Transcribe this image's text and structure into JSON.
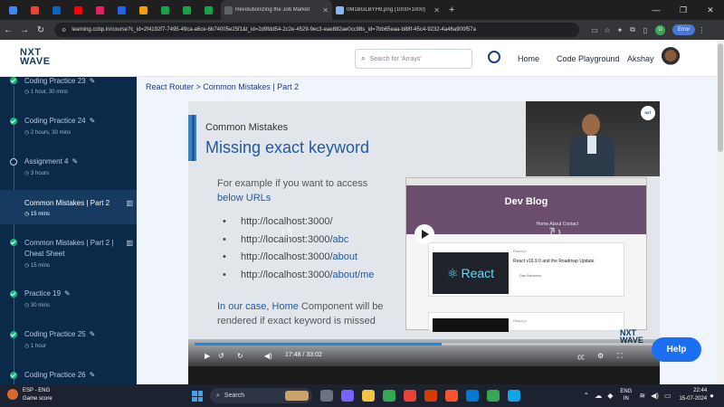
{
  "browser": {
    "tabs": [
      {
        "label": "",
        "color": "#4285f4"
      },
      {
        "label": "",
        "color": "#ea4335"
      },
      {
        "label": "",
        "color": "#0a66c2"
      },
      {
        "label": "",
        "color": "#ff0000"
      },
      {
        "label": "",
        "color": "#e91e63"
      },
      {
        "label": "",
        "color": "#2563eb"
      },
      {
        "label": "",
        "color": "#f59e0b"
      },
      {
        "label": "",
        "color": "#16a34a"
      },
      {
        "label": "",
        "color": "#16a34a"
      },
      {
        "label": "",
        "color": "#16a34a"
      }
    ],
    "tab_active_title": "Revolutionizing the Job Market",
    "tab_image_title": "0M1BGLBYH9.png (1000×1000)",
    "url": "learning.ccbp.in/course?c_id=2f4192f7-7495-49ca-a6ce-6b74005e25f1&t_id=2d9fdd54-2c2e-4529-9ec3-eae882ae0cc98s_id=7bb65eaa-b88f-45c4-9232-4a46a900f57a",
    "profile_initial": "U",
    "error_label": "Error"
  },
  "app": {
    "logo_line1": "NXT",
    "logo_line2": "WAVE",
    "search_placeholder": "Search for 'Arrays'",
    "nav_home": "Home",
    "nav_playground": "Code Playground",
    "user_name": "Akshay",
    "breadcrumb": "React Router > Common Mistakes | Part 2",
    "help_label": "Help"
  },
  "sidebar": {
    "items": [
      {
        "title": "Coding Practice 23",
        "meta": "1 hour, 30 mins",
        "status": "done"
      },
      {
        "title": "Coding Practice 24",
        "meta": "2 hours, 30 mins",
        "status": "done"
      },
      {
        "title": "Assignment 4",
        "meta": "3 hours",
        "status": "todo"
      },
      {
        "title": "Common Mistakes | Part 2",
        "meta": "15 mins",
        "status": "active"
      },
      {
        "title": "Common Mistakes | Part 2 |",
        "title2": "Cheat Sheet",
        "meta": "15 mins",
        "status": "done"
      },
      {
        "title": "Practice 19",
        "meta": "30 mins",
        "status": "done"
      },
      {
        "title": "Coding Practice 25",
        "meta": "1 hour",
        "status": "done"
      },
      {
        "title": "Coding Practice 26",
        "meta": "",
        "status": "done"
      }
    ]
  },
  "slide": {
    "kicker": "Common Mistakes",
    "title": "Missing exact keyword",
    "intro_1": "For example if you want to access",
    "intro_2": "below URLs",
    "urls": [
      {
        "base": "http://localhost:3000/",
        "path": ""
      },
      {
        "base": "http://localhost:3000/",
        "path": "abc"
      },
      {
        "base": "http://localhost:3000/",
        "path": "about"
      },
      {
        "base": "http://localhost:3000/",
        "path": "about/me"
      }
    ],
    "foot_1a": "In our case, Home",
    "foot_1b": " Component will be",
    "foot_2": "rendered if exact keyword is missed",
    "embedded": {
      "blog_title": "Dev Blog",
      "blog_links": "Home   About   Contact",
      "card_meta": "React.js",
      "card_headline": "React v16.9.0 and the Roadmap Update",
      "card_author": "Dan Abramov",
      "card_thumb": "React",
      "card2_meta": "React.js"
    },
    "presenter_badge": "NXT WAVE"
  },
  "player": {
    "current_time": "17:48",
    "separator": "/",
    "duration": "33:02",
    "progress": 0.54,
    "watermark_1": "NXT",
    "watermark_2": "WAVE"
  },
  "taskbar": {
    "widget_line1": "ESP - ENG",
    "widget_line2": "Game score",
    "search_label": "Search",
    "lang_1": "ENG",
    "lang_2": "IN",
    "time": "22:44",
    "date": "15-07-2024"
  }
}
